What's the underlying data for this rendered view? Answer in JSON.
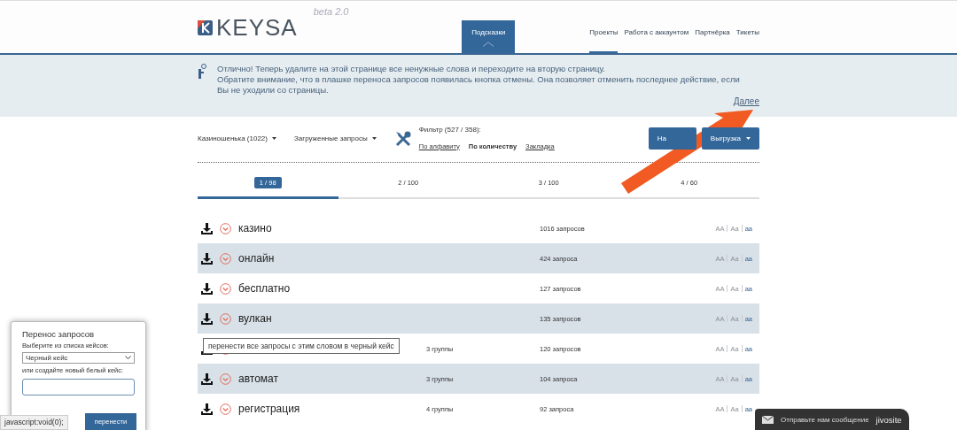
{
  "header": {
    "logo": "KEYSA",
    "version": "beta 2.0",
    "hint_tab": {
      "label": "Подсказки",
      "selected": true
    },
    "nav": [
      {
        "label": "Проекты",
        "selected": true
      },
      {
        "label": "Работа с аккаунтом",
        "selected": false
      },
      {
        "label": "Партнёрка",
        "selected": false
      },
      {
        "label": "Тикеты",
        "selected": false
      }
    ]
  },
  "hint": {
    "lines": [
      "Отлично! Теперь удалите на этой странице все ненужные слова и переходите на вторую страницу.",
      "Обратите внимание, что в плашке переноса запросов появилась кнопка отмены. Она позволяет отменить последнее действие, если Вы не уходили со страницы."
    ],
    "next_link": "Далее"
  },
  "toolbar": {
    "project": "Казиношенька (1022)",
    "source": "Загруженные запросы",
    "filter_title": "Фильтр (527 / 358):",
    "sort": [
      {
        "label": "По алфавиту",
        "selected": false
      },
      {
        "label": "По количеству",
        "selected": true
      },
      {
        "label": "Закладка",
        "selected": false
      }
    ],
    "buttons": [
      "На",
      "Выгрузка"
    ]
  },
  "pages": [
    {
      "label": "1 / 98",
      "selected": true
    },
    {
      "label": "2 / 100",
      "selected": false
    },
    {
      "label": "3 / 100",
      "selected": false
    },
    {
      "label": "4 / 60",
      "selected": false
    }
  ],
  "rows": [
    {
      "word": "казино",
      "groups": "",
      "count": "1016 запросов",
      "cases": [
        {
          "label": "AA",
          "selected": false
        },
        {
          "label": "Aa",
          "selected": false
        },
        {
          "label": "aa",
          "selected": true
        }
      ]
    },
    {
      "word": "онлайн",
      "groups": "",
      "count": "424 запроса",
      "cases": [
        {
          "label": "AA",
          "selected": false
        },
        {
          "label": "Aa",
          "selected": false
        },
        {
          "label": "aa",
          "selected": true
        }
      ]
    },
    {
      "word": "бесплатно",
      "groups": "",
      "count": "127 запросов",
      "cases": [
        {
          "label": "AA",
          "selected": false
        },
        {
          "label": "Aa",
          "selected": false
        },
        {
          "label": "aa",
          "selected": true
        }
      ]
    },
    {
      "word": "вулкан",
      "groups": "",
      "count": "135 запросов",
      "cases": [
        {
          "label": "AA",
          "selected": false
        },
        {
          "label": "Aa",
          "selected": false
        },
        {
          "label": "aa",
          "selected": true
        }
      ]
    },
    {
      "word": "",
      "groups": "3 группы",
      "count": "120 запросов",
      "cases": [
        {
          "label": "AA",
          "selected": false
        },
        {
          "label": "Aa",
          "selected": false
        },
        {
          "label": "aa",
          "selected": true
        }
      ]
    },
    {
      "word": "автомат",
      "groups": "3 группы",
      "count": "104 запроса",
      "cases": [
        {
          "label": "AA",
          "selected": false
        },
        {
          "label": "Aa",
          "selected": false
        },
        {
          "label": "aa",
          "selected": true
        }
      ]
    },
    {
      "word": "регистрация",
      "groups": "4 группы",
      "count": "92 запроса",
      "cases": [
        {
          "label": "AA",
          "selected": false
        },
        {
          "label": "Aa",
          "selected": false
        },
        {
          "label": "aa",
          "selected": true
        }
      ]
    }
  ],
  "tooltip": "перенести все запросы с этим словом в черный кейс",
  "transfer": {
    "title": "Перенос запросов",
    "select_label": "Выберите из списка кейсов:",
    "select_value": "Черный кейс",
    "new_label": "или создайте новый белый кейс:",
    "button": "перенести"
  },
  "status_text": "javascript:void(0);",
  "chat": {
    "label": "Отправьте нам сообщение",
    "brand": "jivosite"
  }
}
